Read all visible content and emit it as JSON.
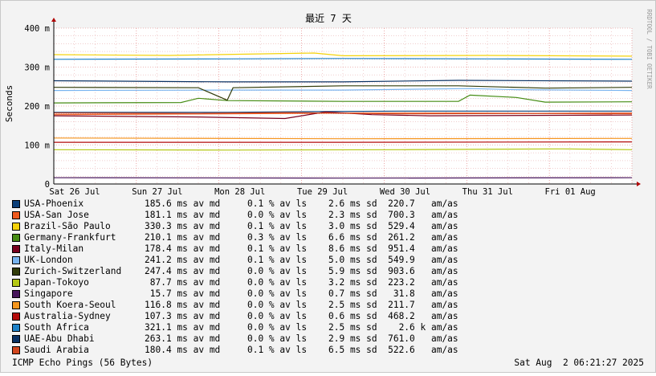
{
  "watermark": "RRDTOOL / TOBI OETIKER",
  "footer_left": "ICMP Echo Pings (56 Bytes)",
  "footer_right": "Sat Aug  2 06:21:27 2025",
  "chart_data": {
    "type": "line",
    "title": "最近 7 天",
    "ylabel": "Seconds",
    "xlabel": "",
    "ylim": [
      0,
      0.4
    ],
    "y_ticks": [
      "0",
      "100 m",
      "200 m",
      "300 m",
      "400 m"
    ],
    "x_ticks": [
      "Sat 26 Jul",
      "Sun 27 Jul",
      "Mon 28 Jul",
      "Tue 29 Jul",
      "Wed 30 Jul",
      "Thu 31 Jul",
      "Fri 01 Aug"
    ],
    "grid": true,
    "legend_position": "bottom",
    "series": [
      {
        "name": "USA-Phoenix",
        "color": "#0a3e78",
        "avg_ms": 185.6,
        "loss_pct": 0.1,
        "sd_ms": 2.6,
        "am": 220.7,
        "text": "185.6 ms av md     0.1 % av ls    2.6 ms sd  220.7   am/as",
        "points": [
          [
            0,
            184
          ],
          [
            0.3,
            184
          ],
          [
            0.47,
            186
          ],
          [
            0.6,
            187
          ],
          [
            0.8,
            187
          ],
          [
            1,
            187
          ]
        ]
      },
      {
        "name": "USA-San Jose",
        "color": "#f05a1e",
        "avg_ms": 181.1,
        "loss_pct": 0.0,
        "sd_ms": 2.3,
        "am": 700.3,
        "text": "181.1 ms av md     0.0 % av ls    2.3 ms sd  700.3   am/as",
        "points": [
          [
            0,
            178
          ],
          [
            0.3,
            180
          ],
          [
            0.5,
            182
          ],
          [
            0.7,
            182
          ],
          [
            1,
            180
          ]
        ]
      },
      {
        "name": "Brazil-São Paulo",
        "color": "#f5d20a",
        "avg_ms": 330.3,
        "loss_pct": 0.1,
        "sd_ms": 3.0,
        "am": 529.4,
        "text": "330.3 ms av md     0.1 % av ls    3.0 ms sd  529.4   am/as",
        "points": [
          [
            0,
            332
          ],
          [
            0.2,
            330
          ],
          [
            0.45,
            336
          ],
          [
            0.5,
            329
          ],
          [
            0.75,
            330
          ],
          [
            1,
            328
          ]
        ]
      },
      {
        "name": "Germany-Frankfurt",
        "color": "#468c14",
        "avg_ms": 210.1,
        "loss_pct": 0.3,
        "sd_ms": 6.6,
        "am": 261.2,
        "text": "210.1 ms av md     0.3 % av ls    6.6 ms sd  261.2   am/as",
        "points": [
          [
            0,
            208
          ],
          [
            0.22,
            209
          ],
          [
            0.25,
            220
          ],
          [
            0.3,
            214
          ],
          [
            0.5,
            212
          ],
          [
            0.7,
            212
          ],
          [
            0.72,
            228
          ],
          [
            0.8,
            222
          ],
          [
            0.85,
            210
          ],
          [
            1,
            211
          ]
        ]
      },
      {
        "name": "Italy-Milan",
        "color": "#78001e",
        "avg_ms": 178.4,
        "loss_pct": 0.1,
        "sd_ms": 8.6,
        "am": 951.4,
        "text": "178.4 ms av md     0.1 % av ls    8.6 ms sd  951.4   am/as",
        "points": [
          [
            0,
            175
          ],
          [
            0.25,
            172
          ],
          [
            0.4,
            168
          ],
          [
            0.47,
            185
          ],
          [
            0.55,
            178
          ],
          [
            0.65,
            175
          ],
          [
            1,
            177
          ]
        ]
      },
      {
        "name": "UK-London",
        "color": "#78b4f0",
        "avg_ms": 241.2,
        "loss_pct": 0.1,
        "sd_ms": 5.0,
        "am": 549.9,
        "text": "241.2 ms av md     0.1 % av ls    5.0 ms sd  549.9   am/as",
        "points": [
          [
            0,
            240
          ],
          [
            0.3,
            241
          ],
          [
            0.5,
            241
          ],
          [
            0.72,
            245
          ],
          [
            0.8,
            242
          ],
          [
            1,
            240
          ]
        ]
      },
      {
        "name": "Zurich-Switzerland",
        "color": "#323c0a",
        "avg_ms": 247.4,
        "loss_pct": 0.0,
        "sd_ms": 5.9,
        "am": 903.6,
        "text": "247.4 ms av md     0.0 % av ls    5.9 ms sd  903.6   am/as",
        "points": [
          [
            0,
            248
          ],
          [
            0.25,
            247
          ],
          [
            0.3,
            215
          ],
          [
            0.31,
            247
          ],
          [
            0.5,
            252
          ],
          [
            0.7,
            252
          ],
          [
            0.85,
            246
          ],
          [
            1,
            248
          ]
        ]
      },
      {
        "name": "Japan-Tokoyo",
        "color": "#b4c814",
        "avg_ms": 87.7,
        "loss_pct": 0.0,
        "sd_ms": 3.2,
        "am": 223.2,
        "text": " 87.7 ms av md     0.0 % av ls    3.2 ms sd  223.2   am/as",
        "points": [
          [
            0,
            88
          ],
          [
            0.3,
            87
          ],
          [
            0.6,
            88
          ],
          [
            0.88,
            90
          ],
          [
            1,
            88
          ]
        ]
      },
      {
        "name": "Singapore",
        "color": "#46145a",
        "avg_ms": 15.7,
        "loss_pct": 0.0,
        "sd_ms": 0.7,
        "am": 31.8,
        "text": " 15.7 ms av md     0.0 % av ls    0.7 ms sd   31.8   am/as",
        "points": [
          [
            0,
            16
          ],
          [
            0.5,
            15
          ],
          [
            1,
            16
          ]
        ]
      },
      {
        "name": "South Koera-Seoul",
        "color": "#f5961e",
        "avg_ms": 116.8,
        "loss_pct": 0.0,
        "sd_ms": 2.5,
        "am": 211.7,
        "text": "116.8 ms av md     0.0 % av ls    2.5 ms sd  211.7   am/as",
        "points": [
          [
            0,
            118
          ],
          [
            0.5,
            116
          ],
          [
            1,
            117
          ]
        ]
      },
      {
        "name": "Australia-Sydney",
        "color": "#b40a0a",
        "avg_ms": 107.3,
        "loss_pct": 0.0,
        "sd_ms": 0.6,
        "am": 468.2,
        "text": "107.3 ms av md     0.0 % av ls    0.6 ms sd  468.2   am/as",
        "points": [
          [
            0,
            107
          ],
          [
            0.5,
            107
          ],
          [
            1,
            108
          ]
        ]
      },
      {
        "name": "South Africa",
        "color": "#1e82c8",
        "avg_ms": 321.1,
        "loss_pct": 0.0,
        "sd_ms": 2.5,
        "am": "2.6 k",
        "text": "321.1 ms av md     0.0 % av ls    2.5 ms sd    2.6 k am/as",
        "points": [
          [
            0,
            320
          ],
          [
            0.3,
            321
          ],
          [
            0.5,
            322
          ],
          [
            0.75,
            321
          ],
          [
            1,
            320
          ]
        ]
      },
      {
        "name": "UAE-Abu Dhabi",
        "color": "#0a3264",
        "avg_ms": 263.1,
        "loss_pct": 0.0,
        "sd_ms": 2.9,
        "am": 761.0,
        "text": "263.1 ms av md     0.0 % av ls    2.9 ms sd  761.0   am/as",
        "points": [
          [
            0,
            265
          ],
          [
            0.3,
            262
          ],
          [
            0.5,
            262
          ],
          [
            0.7,
            266
          ],
          [
            1,
            264
          ]
        ]
      },
      {
        "name": "Saudi Arabia",
        "color": "#d2461e",
        "avg_ms": 180.4,
        "loss_pct": 0.1,
        "sd_ms": 6.5,
        "am": 522.6,
        "text": "180.4 ms av md     0.1 % av ls    6.5 ms sd  522.6   am/as",
        "points": [
          [
            0,
            182
          ],
          [
            0.25,
            181
          ],
          [
            0.4,
            183
          ],
          [
            0.6,
            180
          ],
          [
            1,
            182
          ]
        ]
      }
    ]
  }
}
